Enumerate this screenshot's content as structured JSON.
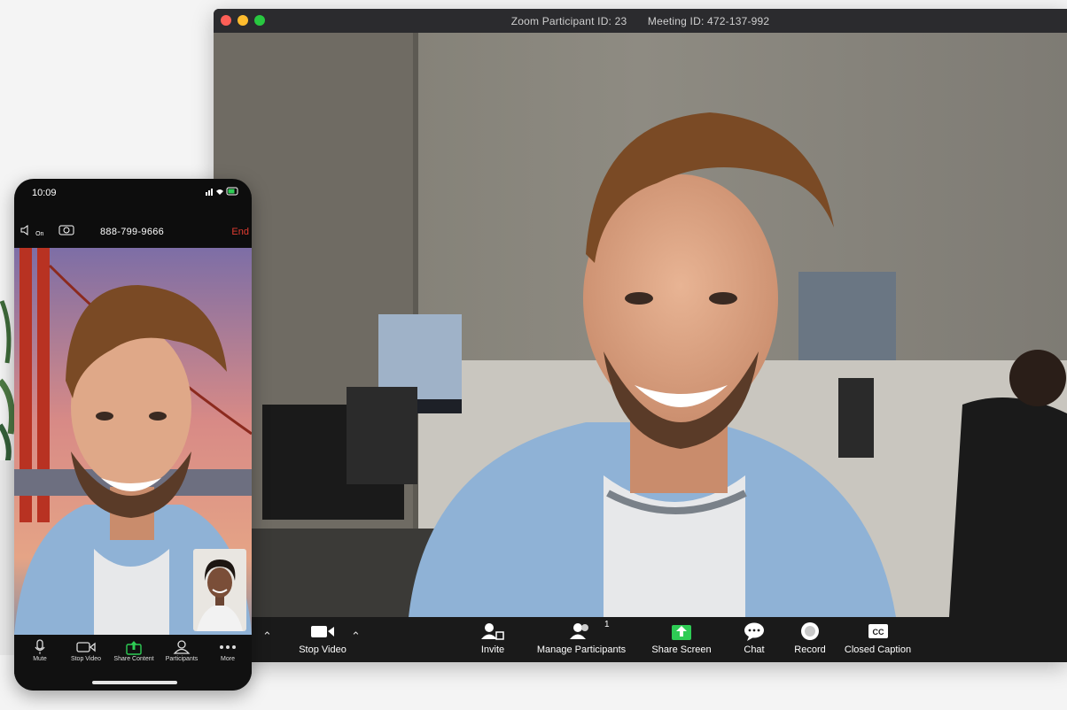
{
  "window": {
    "participant_id": "Zoom Participant ID: 23",
    "meeting_id": "Meeting ID: 472-137-992"
  },
  "toolbar": {
    "stop_video": "Stop Video",
    "invite": "Invite",
    "manage_participants": "Manage Participants",
    "participant_count": "1",
    "share_screen": "Share Screen",
    "chat": "Chat",
    "record": "Record",
    "closed_caption": "Closed Caption"
  },
  "phone": {
    "time": "10:09",
    "phone_number": "888-799-9666",
    "end_label": "End",
    "speaker_label": "On",
    "toolbar": {
      "mute": "Mute",
      "stop_video": "Stop Video",
      "share_content": "Share Content",
      "participants": "Participants",
      "more": "More"
    }
  },
  "colors": {
    "share_green": "#2ecc55",
    "end_red": "#e03c31",
    "toolbar_bg": "#1a1a1a"
  }
}
